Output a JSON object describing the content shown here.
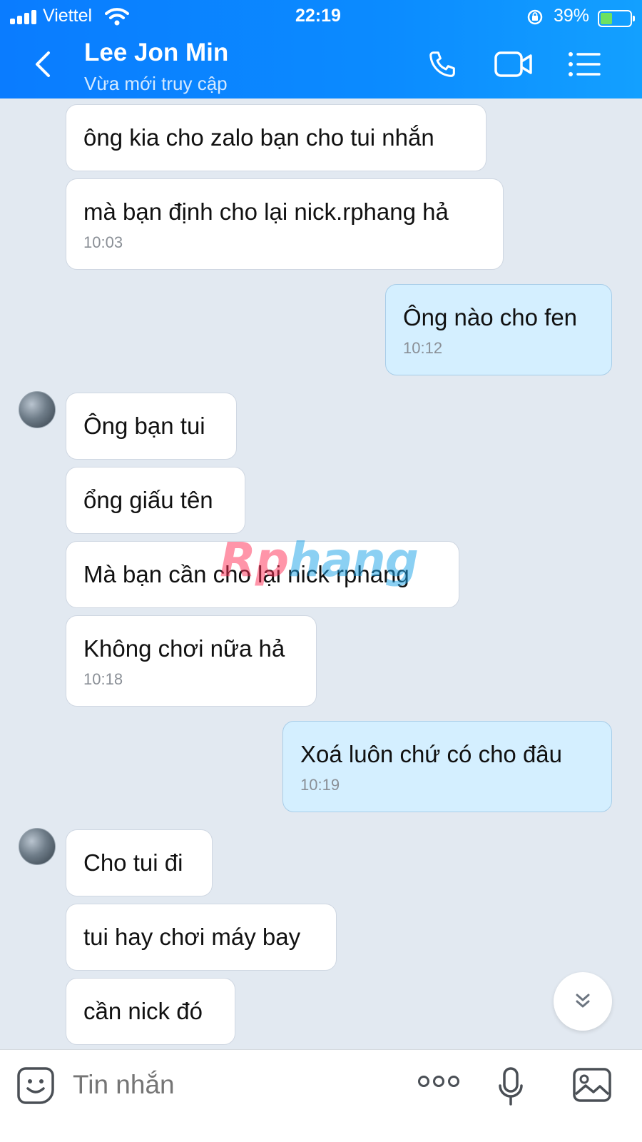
{
  "status_bar": {
    "carrier": "Viettel",
    "time": "22:19",
    "battery_percent": "39%",
    "battery_level": 0.39
  },
  "header": {
    "contact_name": "Lee Jon Min",
    "subtitle": "Vừa mới truy cập"
  },
  "messages": [
    {
      "side": "in",
      "text": "ông kia cho zalo bạn cho tui nhắn",
      "time": ""
    },
    {
      "side": "in",
      "text": "mà bạn định cho lại nick.rphang hả",
      "time": "10:03"
    },
    {
      "side": "out",
      "text": "Ông nào cho fen",
      "time": "10:12"
    },
    {
      "side": "in",
      "text": "Ông bạn tui",
      "time": ""
    },
    {
      "side": "in",
      "text": "ổng giấu tên",
      "time": ""
    },
    {
      "side": "in",
      "text": "Mà bạn cần cho lại nick rphang",
      "time": ""
    },
    {
      "side": "in",
      "text": "Không chơi nữa hả",
      "time": "10:18"
    },
    {
      "side": "out",
      "text": "Xoá luôn chứ có cho đâu",
      "time": "10:19"
    },
    {
      "side": "in",
      "text": "Cho tui đi",
      "time": ""
    },
    {
      "side": "in",
      "text": "tui hay chơi máy bay",
      "time": ""
    },
    {
      "side": "in",
      "text": "cần nick đó",
      "time": ""
    }
  ],
  "watermark": {
    "part1": "Rp",
    "part2": "hang"
  },
  "input": {
    "placeholder": "Tin nhắn"
  },
  "colors": {
    "header": "#0a7cff",
    "outgoing_bubble": "#d4efff",
    "incoming_bubble": "#ffffff",
    "background": "#e2e9f1"
  },
  "icons": {
    "header": [
      "back-chevron-icon",
      "phone-icon",
      "video-call-icon",
      "menu-list-icon"
    ],
    "input_bar": [
      "sticker-icon",
      "more-icon",
      "microphone-icon",
      "image-icon"
    ],
    "other": [
      "scroll-down-icon"
    ]
  }
}
